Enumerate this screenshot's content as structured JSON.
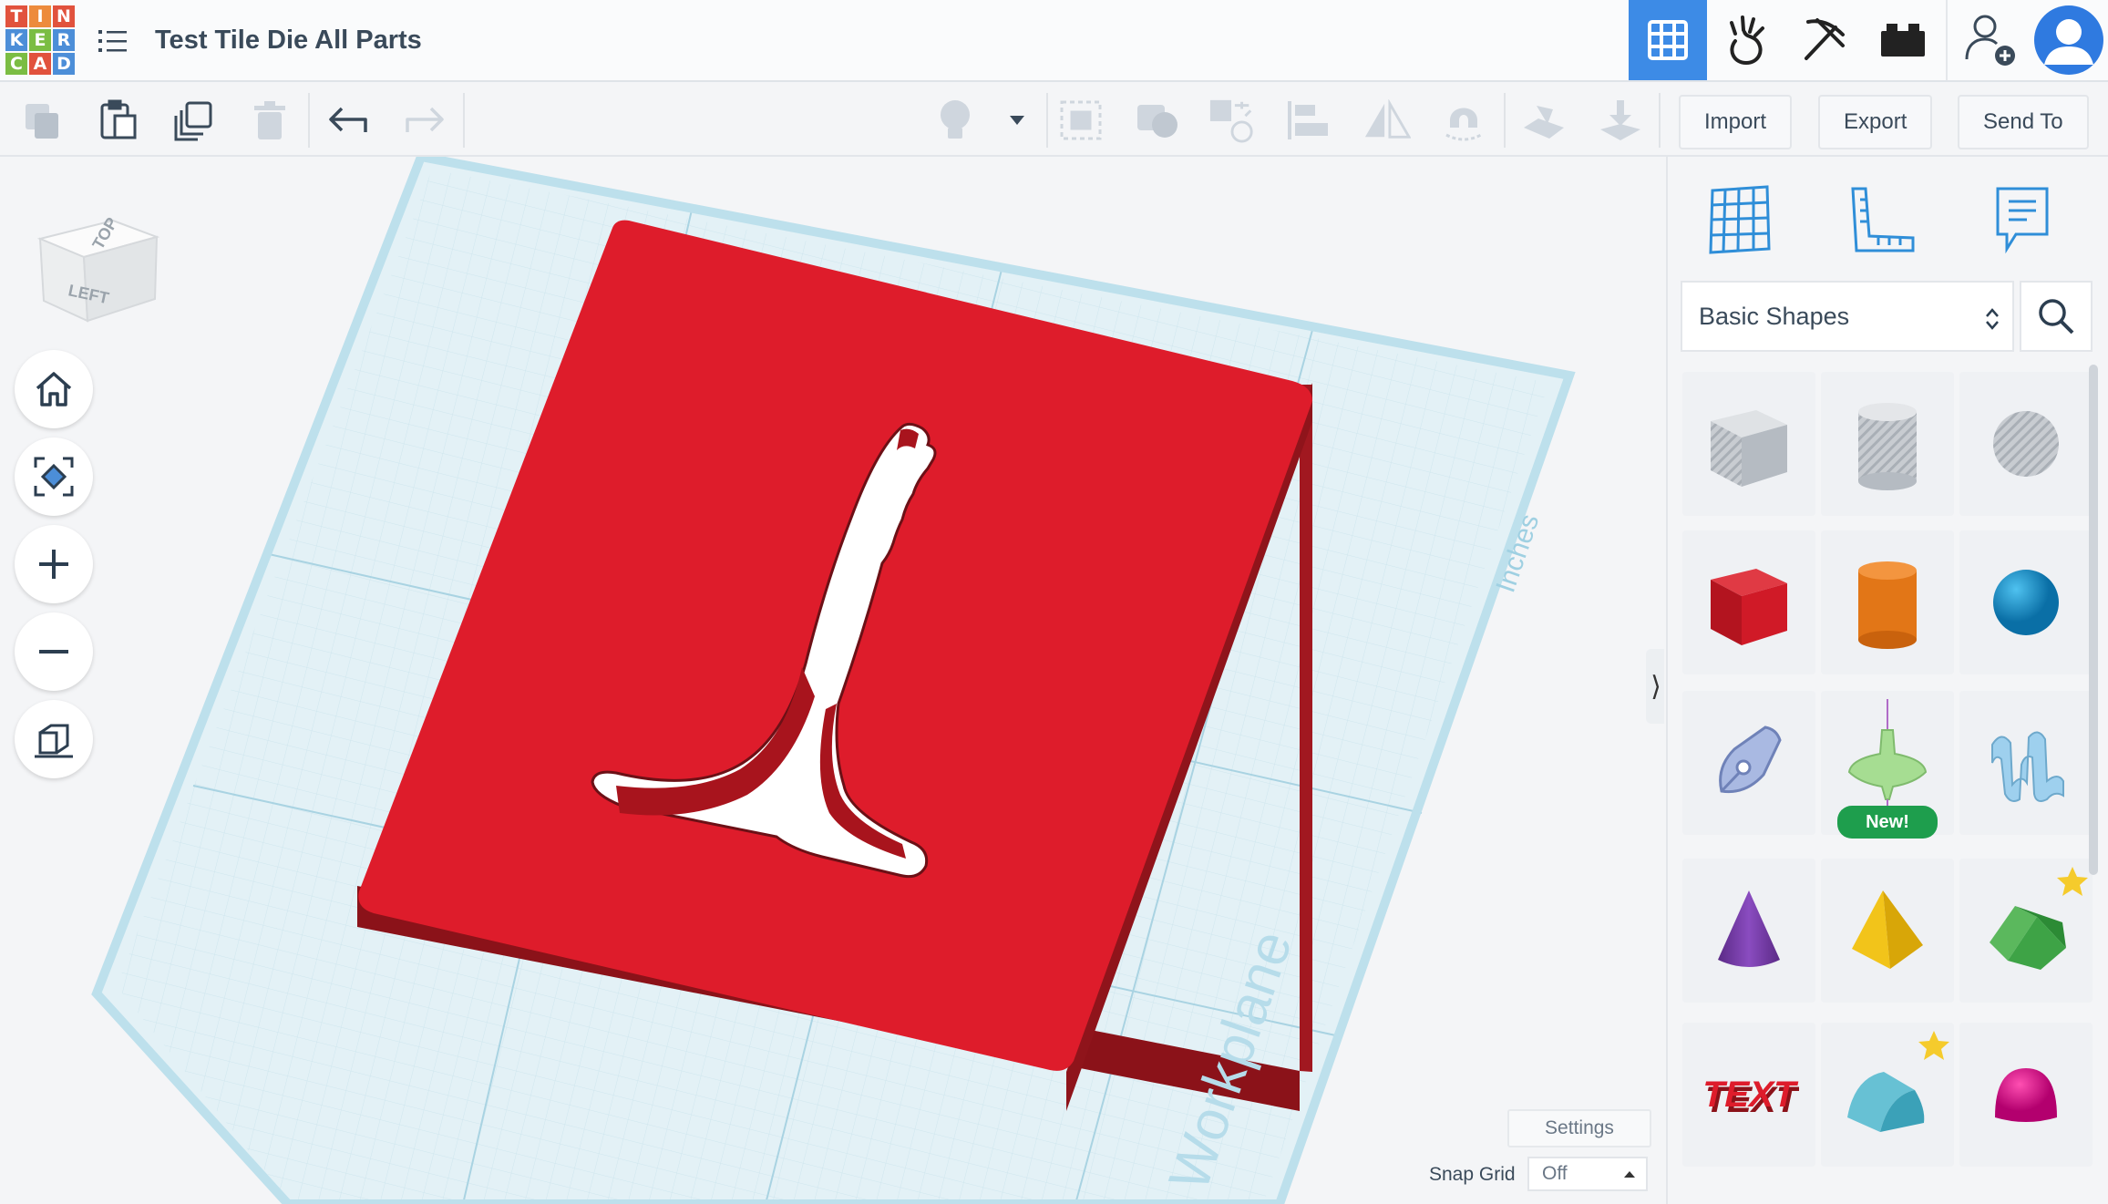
{
  "app": {
    "logo_letters": [
      "T",
      "I",
      "N",
      "K",
      "E",
      "R",
      "C",
      "A",
      "D"
    ],
    "logo_colors": [
      "#e1523d",
      "#ed8b3c",
      "#4c8ed8",
      "#7bbd43",
      "#e1523d",
      "#ed8b3c",
      "#4c8ed8",
      "#7bbd43",
      "#4c8ed8"
    ],
    "title": "Test Tile Die All Parts",
    "accent": "#3d8be6"
  },
  "topbar": {
    "icons": [
      "grid-view-icon",
      "sim-lab-icon",
      "pickaxe-icon",
      "bricks-icon",
      "add-user-icon",
      "profile-avatar-icon"
    ]
  },
  "toolbar": {
    "import_label": "Import",
    "export_label": "Export",
    "sendto_label": "Send To"
  },
  "workspace": {
    "viewcube_top": "TOP",
    "viewcube_left": "LEFT",
    "workplane_label": "Workplane",
    "units_label": "Inches",
    "settings_label": "Settings",
    "snap_label": "Snap Grid",
    "snap_value": "Off",
    "object_color": "#de1c2b"
  },
  "panel": {
    "category": "Basic Shapes",
    "new_badge": "New!",
    "shapes": [
      "box-hole",
      "cylinder-hole",
      "sphere-hole",
      "box",
      "cylinder",
      "sphere",
      "scribble",
      "shape-generator",
      "text-3d",
      "cone",
      "pyramid",
      "roof",
      "text",
      "half-cylinder",
      "paraboloid"
    ]
  }
}
